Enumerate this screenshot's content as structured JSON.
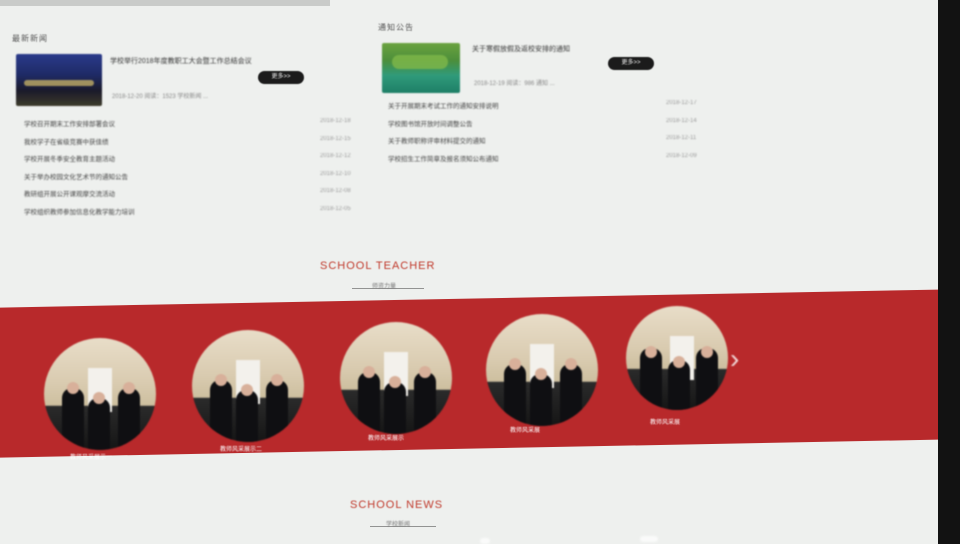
{
  "left_column": {
    "label": "最新新闻",
    "featured": {
      "title": "学校举行2018年度教职工大会暨工作总结会议",
      "meta": "2018-12-20  阅读：1523  学校新闻 ...",
      "more": "更多>>"
    },
    "items": [
      {
        "title": "学校召开期末工作安排部署会议",
        "date": "2018-12-18"
      },
      {
        "title": "我校学子在省级竞赛中获佳绩",
        "date": "2018-12-15"
      },
      {
        "title": "学校开展冬季安全教育主题活动",
        "date": "2018-12-12"
      },
      {
        "title": "关于举办校园文化艺术节的通知公告",
        "date": "2018-12-10"
      },
      {
        "title": "教研组开展公开课观摩交流活动",
        "date": "2018-12-08"
      },
      {
        "title": "学校组织教师参加信息化教学能力培训",
        "date": "2018-12-05"
      }
    ]
  },
  "right_column": {
    "label": "通知公告",
    "featured": {
      "title": "关于寒假放假及返校安排的通知",
      "meta": "2018-12-19  阅读：986  通知 ...",
      "more": "更多>>"
    },
    "items": [
      {
        "title": "关于开展期末考试工作的通知安排说明",
        "date": "2018-12-17"
      },
      {
        "title": "学校图书馆开放时间调整公告",
        "date": "2018-12-14"
      },
      {
        "title": "关于教师职称评审材料提交的通知",
        "date": "2018-12-11"
      },
      {
        "title": "学校招生工作简章及报名须知公布通知",
        "date": "2018-12-09"
      }
    ]
  },
  "teachers_section": {
    "title": "SCHOOL TEACHER",
    "subtitle": "师资力量",
    "teachers": [
      {
        "name": "教师风采展示一"
      },
      {
        "name": "教师风采展示二"
      },
      {
        "name": "教师风采展示"
      },
      {
        "name": "教师风采展"
      },
      {
        "name": "教师风采展"
      }
    ],
    "next_glyph": "›"
  },
  "news_section": {
    "title": "SCHOOL NEWS",
    "subtitle": "学校新闻"
  },
  "colors": {
    "accent": "#b8292b",
    "title_red": "#c0392b",
    "background": "#eef0ee"
  }
}
